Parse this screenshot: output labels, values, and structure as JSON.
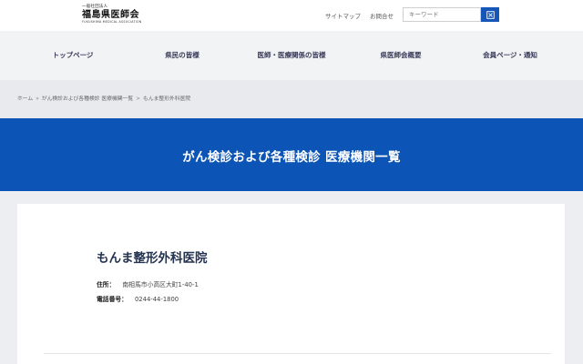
{
  "header": {
    "logo": {
      "org_type": "一般社団法人",
      "name": "福島県医師会",
      "english": "FUKUSHIMA MEDICAL ASSOCIATION"
    },
    "links": {
      "sitemap": "サイトマップ",
      "contact": "お問合せ"
    },
    "search": {
      "placeholder": "キーワード"
    }
  },
  "nav": {
    "items": [
      {
        "label": "トップページ"
      },
      {
        "label": "県民の皆様"
      },
      {
        "label": "医師・医療関係の皆様"
      },
      {
        "label": "県医師会概要"
      },
      {
        "label": "会員ページ・通知"
      }
    ]
  },
  "breadcrumb": {
    "items": [
      "ホーム",
      "がん検診および各種検診 医療機関一覧",
      "もんま整形外科医院"
    ],
    "separator": "»"
  },
  "hero": {
    "title": "がん検診および各種検診 医療機関一覧"
  },
  "clinic": {
    "name": "もんま整形外科医院",
    "address_label": "住所：",
    "address": "南相馬市小高区大町1-40-1",
    "phone_label": "電話番号：",
    "phone": "0244-44-1800"
  },
  "colors": {
    "brand_blue": "#0c54b6",
    "nav_bg": "#f2f3f5",
    "search_button": "#1556b8"
  },
  "icons": {
    "search_button": "search-icon"
  }
}
